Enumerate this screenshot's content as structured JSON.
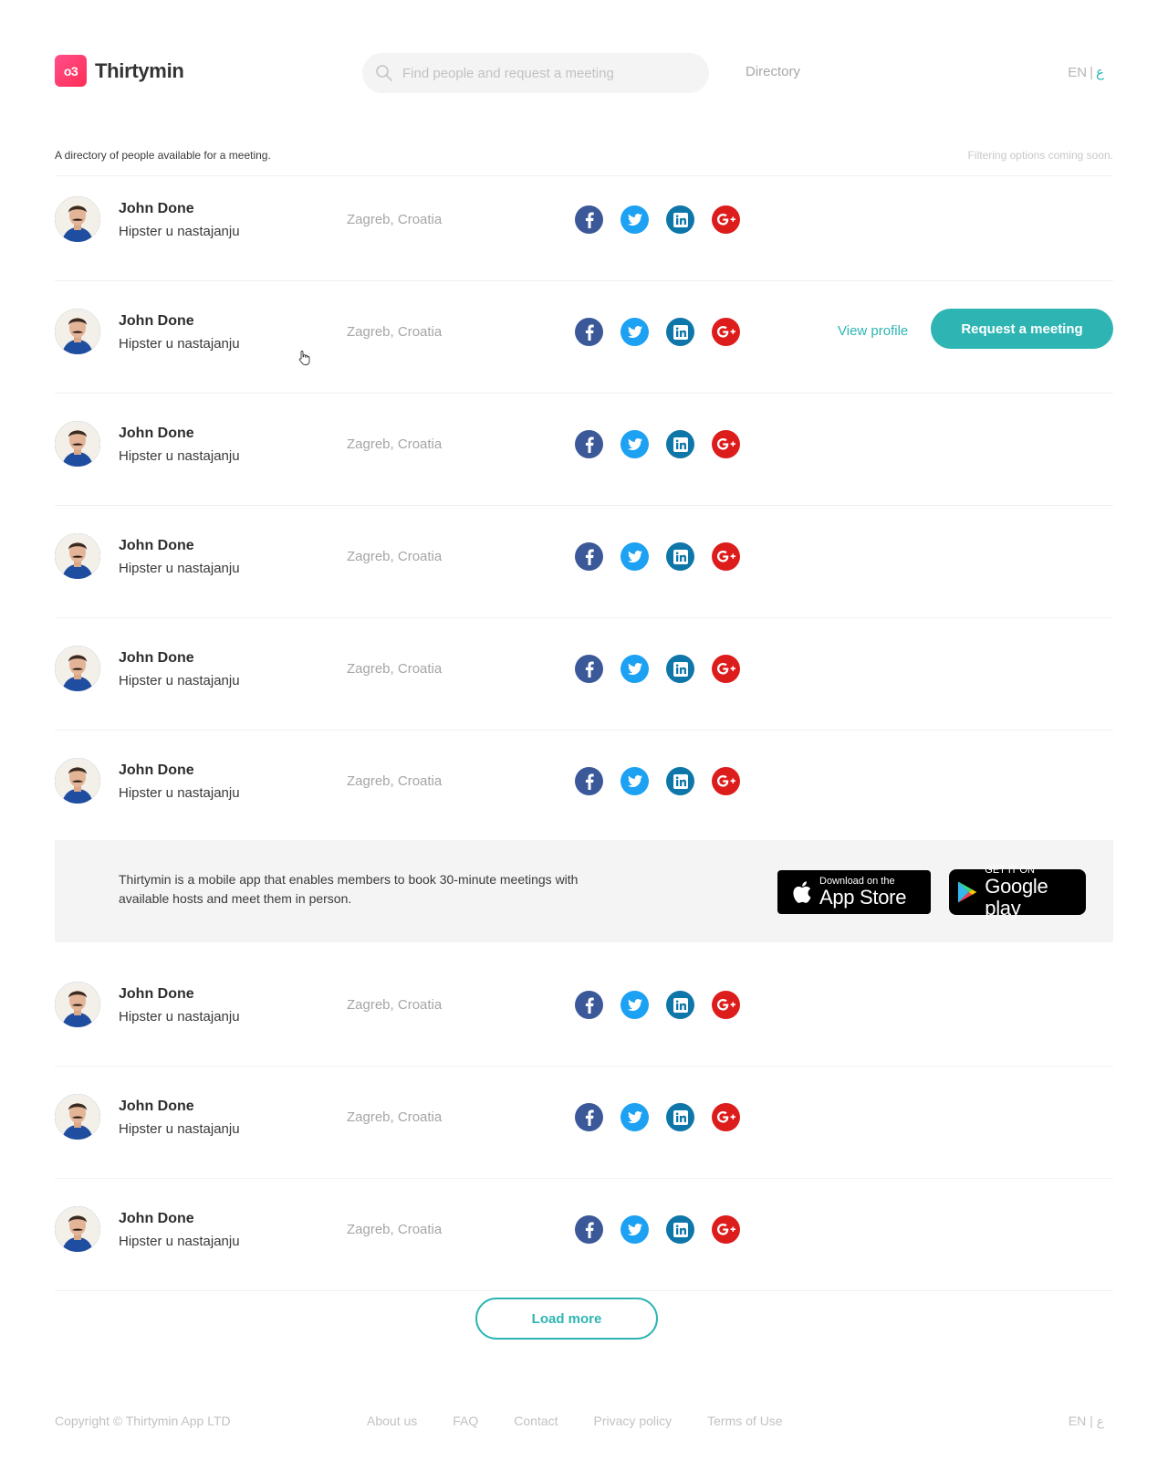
{
  "header": {
    "logo_mark": "o3",
    "logo_text": "Thirtymin",
    "search_placeholder": "Find people and request a meeting",
    "nav_directory": "Directory",
    "lang_en": "EN",
    "lang_sep": "|",
    "lang_ar": "ع"
  },
  "subheader": {
    "description": "A directory of people available for a meeting.",
    "filter_note": "Filtering options coming soon."
  },
  "people": [
    {
      "name": "John Done",
      "title": "Hipster u nastajanju",
      "location": "Zagreb, Croatia"
    },
    {
      "name": "John Done",
      "title": "Hipster u nastajanju",
      "location": "Zagreb, Croatia"
    },
    {
      "name": "John Done",
      "title": "Hipster u nastajanju",
      "location": "Zagreb, Croatia"
    },
    {
      "name": "John Done",
      "title": "Hipster u nastajanju",
      "location": "Zagreb, Croatia"
    },
    {
      "name": "John Done",
      "title": "Hipster u nastajanju",
      "location": "Zagreb, Croatia"
    },
    {
      "name": "John Done",
      "title": "Hipster u nastajanju",
      "location": "Zagreb, Croatia"
    },
    {
      "name": "John Done",
      "title": "Hipster u nastajanju",
      "location": "Zagreb, Croatia"
    },
    {
      "name": "John Done",
      "title": "Hipster u nastajanju",
      "location": "Zagreb, Croatia"
    },
    {
      "name": "John Done",
      "title": "Hipster u nastajanju",
      "location": "Zagreb, Croatia"
    }
  ],
  "row_actions": {
    "view_profile": "View profile",
    "request_meeting": "Request a meeting"
  },
  "social_icons": [
    "facebook-icon",
    "twitter-icon",
    "linkedin-icon",
    "google-plus-icon"
  ],
  "promo": {
    "text": "Thirtymin is a mobile app that enables members to book 30-minute meetings with available hosts and meet them in person.",
    "apple_small": "Download on the",
    "apple_big": "App Store",
    "google_small": "GET IT ON",
    "google_big": "Google play"
  },
  "load_more": "Load more",
  "footer": {
    "copyright": "Copyright © Thirtymin App LTD",
    "links": [
      "About us",
      "FAQ",
      "Contact",
      "Privacy policy",
      "Terms of Use"
    ],
    "lang_en": "EN",
    "lang_sep": "|",
    "lang_ar": "ع"
  },
  "colors": {
    "accent": "#2eb5b3",
    "brand": "#ff3a6e",
    "facebook": "#3b5998",
    "twitter": "#1da1f2",
    "linkedin": "#0e76a8",
    "google_plus": "#dd1c1c"
  }
}
